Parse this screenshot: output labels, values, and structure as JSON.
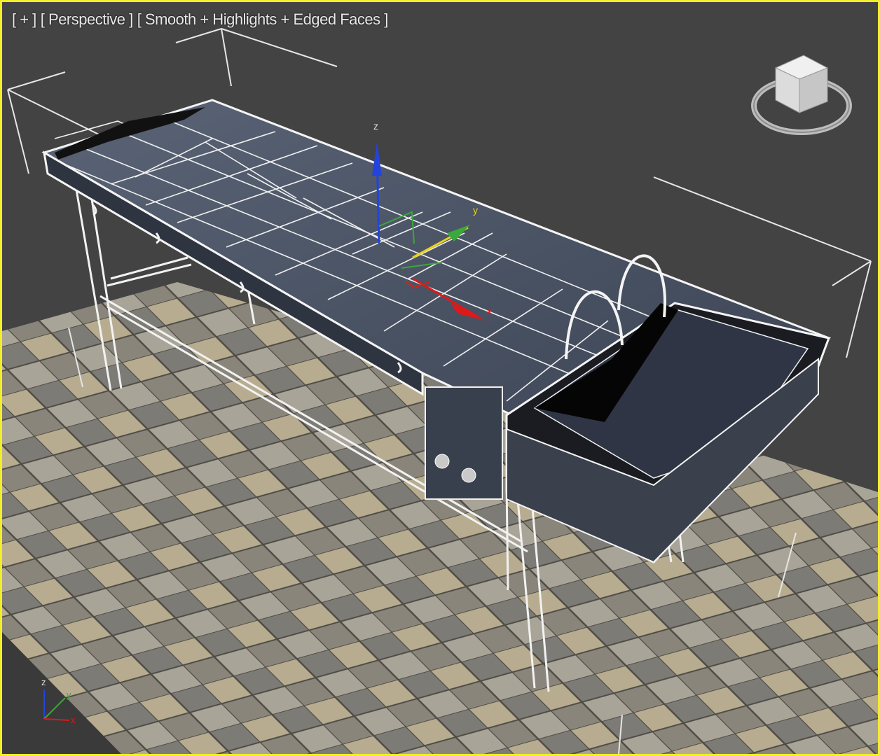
{
  "viewport": {
    "label_plus": "[ + ]",
    "label_view": "[ Perspective ]",
    "label_shading": "[ Smooth + Highlights + Edged Faces ]",
    "border_color": "#f2ee2a",
    "background_color": "#434343"
  },
  "gizmo": {
    "axis_x": "x",
    "axis_y": "y",
    "axis_z": "z",
    "colors": {
      "x": "#e01818",
      "y": "#3aa83a",
      "z": "#2244dd",
      "plane": "#e8d21a"
    }
  },
  "axis_tripod": {
    "x": "x",
    "y": "y",
    "z": "z"
  },
  "viewcube": {
    "icon": "viewcube-icon"
  }
}
